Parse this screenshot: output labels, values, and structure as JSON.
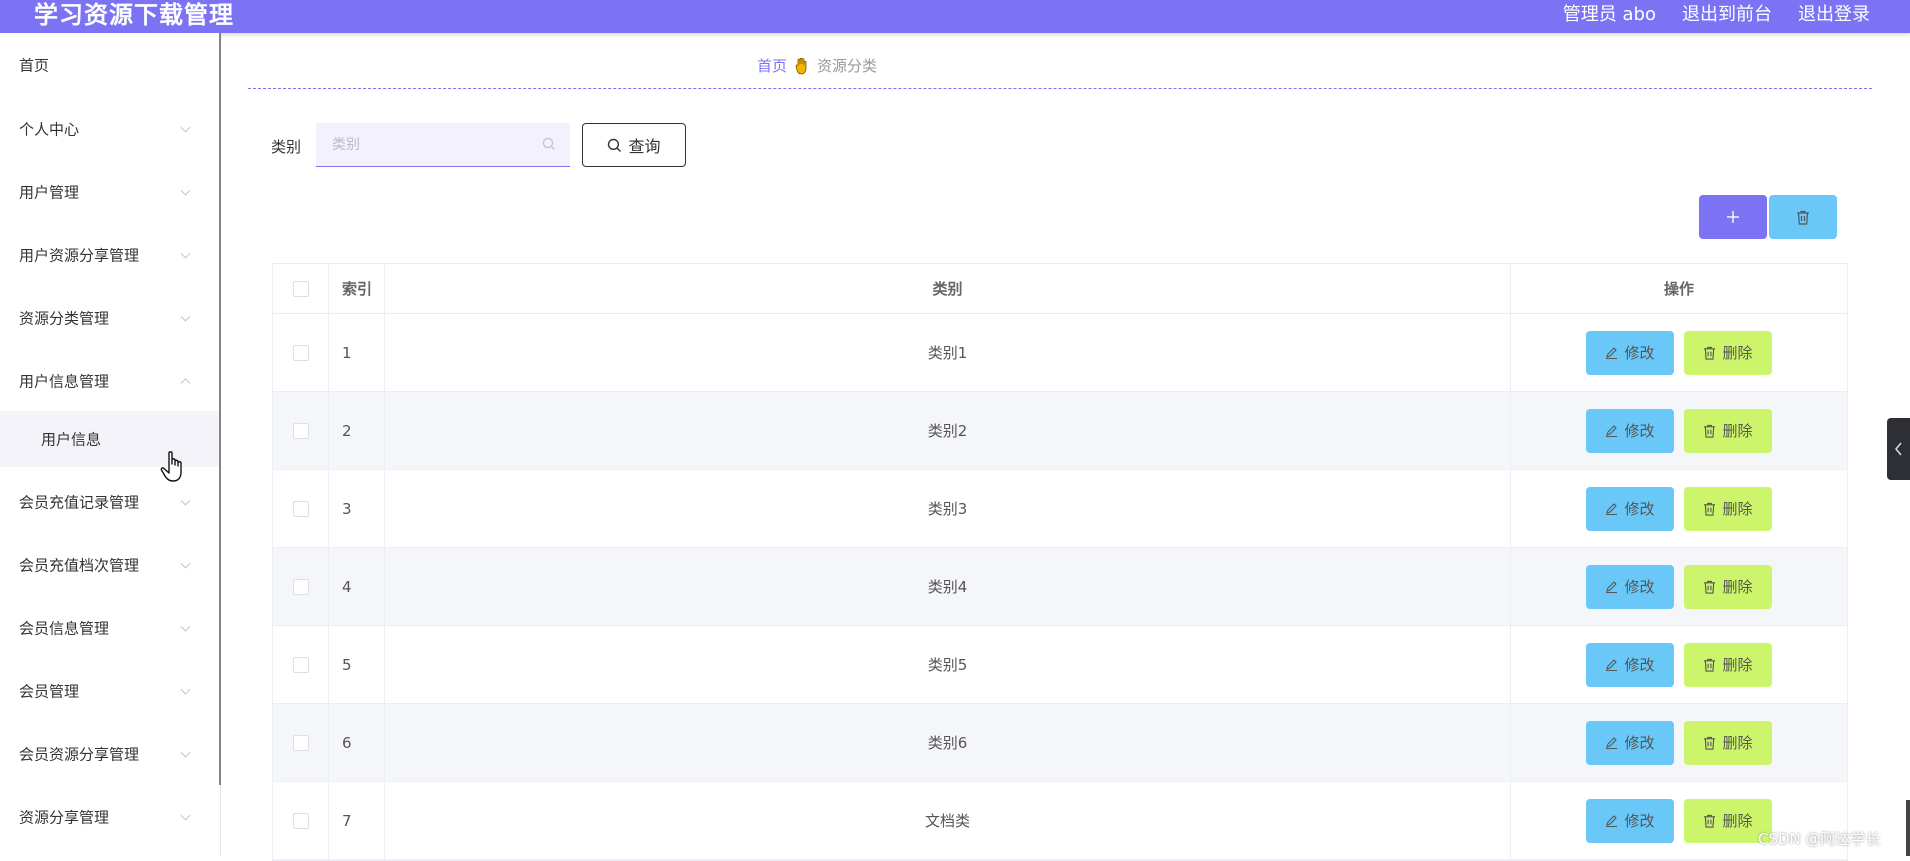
{
  "app": {
    "title": "学习资源下载管理",
    "header_links": [
      "管理员 abo",
      "退出到前台",
      "退出登录"
    ]
  },
  "sidebar": {
    "items": [
      {
        "label": "首页",
        "has_arrow": false
      },
      {
        "label": "个人中心",
        "has_arrow": true
      },
      {
        "label": "用户管理",
        "has_arrow": true
      },
      {
        "label": "用户资源分享管理",
        "has_arrow": true
      },
      {
        "label": "资源分类管理",
        "has_arrow": true
      },
      {
        "label": "用户信息管理",
        "has_arrow": true,
        "expanded": true
      },
      {
        "label": "会员充值记录管理",
        "has_arrow": true
      },
      {
        "label": "会员充值档次管理",
        "has_arrow": true
      },
      {
        "label": "会员信息管理",
        "has_arrow": true
      },
      {
        "label": "会员管理",
        "has_arrow": true
      },
      {
        "label": "会员资源分享管理",
        "has_arrow": true
      },
      {
        "label": "资源分享管理",
        "has_arrow": true
      }
    ],
    "submenu": {
      "label": "用户信息"
    }
  },
  "breadcrumb": {
    "home": "首页",
    "current": "资源分类"
  },
  "search": {
    "label": "类别",
    "placeholder": "类别",
    "value": "",
    "button_label": "查询"
  },
  "actions": {
    "add_icon": "plus-icon",
    "bulk_delete_icon": "trash-icon"
  },
  "table": {
    "headers": {
      "index": "索引",
      "category": "类别",
      "operations": "操作"
    },
    "edit_label": "修改",
    "delete_label": "删除",
    "rows": [
      {
        "index": "1",
        "category": "类别1"
      },
      {
        "index": "2",
        "category": "类别2"
      },
      {
        "index": "3",
        "category": "类别3"
      },
      {
        "index": "4",
        "category": "类别4"
      },
      {
        "index": "5",
        "category": "类别5"
      },
      {
        "index": "6",
        "category": "类别6"
      },
      {
        "index": "7",
        "category": "文档类"
      }
    ]
  },
  "colors": {
    "primary": "#7b73f4",
    "edit": "#69c8f7",
    "delete": "#cdf56b"
  },
  "watermark": "CSDN @阿达学长"
}
